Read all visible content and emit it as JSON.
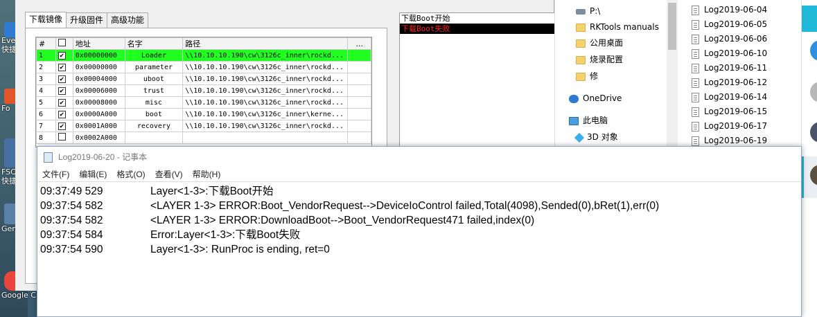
{
  "desktop": {
    "icons": [
      {
        "label": "Every\n快捷",
        "color": "#2f7bd4"
      },
      {
        "label": "Fo",
        "color": "#e2572a"
      },
      {
        "label": "FSCa\n快捷",
        "color": "#4a6fa5"
      },
      {
        "label": "Ger",
        "color": "#5a7fa8"
      },
      {
        "label": "Google Ch",
        "color": "#e8453c"
      }
    ]
  },
  "rk": {
    "tabs": [
      "下载镜像",
      "升级固件",
      "高级功能"
    ],
    "columns": [
      "#",
      "",
      "地址",
      "名字",
      "路径",
      "..."
    ],
    "rows": [
      {
        "num": "1",
        "addr": "0x00000000",
        "name": "Loader",
        "path": "\\\\10.10.10.190\\cw\\3126c_inner\\rockd..."
      },
      {
        "num": "2",
        "addr": "0x00000000",
        "name": "parameter",
        "path": "\\\\10.10.10.190\\cw\\3126c_inner\\rockd..."
      },
      {
        "num": "3",
        "addr": "0x00004000",
        "name": "uboot",
        "path": "\\\\10.10.10.190\\cw\\3126c_inner\\rockd..."
      },
      {
        "num": "4",
        "addr": "0x00006000",
        "name": "trust",
        "path": "\\\\10.10.10.190\\cw\\3126c_inner\\rockd..."
      },
      {
        "num": "5",
        "addr": "0x00008000",
        "name": "misc",
        "path": "\\\\10.10.10.190\\cw\\3126c_inner\\rockd..."
      },
      {
        "num": "6",
        "addr": "0x0000A000",
        "name": "boot",
        "path": "\\\\10.10.10.190\\cw\\3126c_inner\\kerne..."
      },
      {
        "num": "7",
        "addr": "0x0001A000",
        "name": "recovery",
        "path": "\\\\10.10.10.190\\cw\\3126c_inner\\rockd..."
      },
      {
        "num": "8",
        "addr": "0x0002A000",
        "name": "",
        "path": ""
      }
    ],
    "log": [
      {
        "text": "下载Boot开始",
        "error": false
      },
      {
        "text": "下载Boot失败",
        "error": true
      }
    ]
  },
  "explorer": {
    "nav": [
      {
        "label": "P:\\",
        "type": "drive",
        "pinned": true
      },
      {
        "label": "RKTools manuals",
        "type": "folder"
      },
      {
        "label": "公用桌面",
        "type": "folder"
      },
      {
        "label": "烧录配置",
        "type": "folder"
      },
      {
        "label": "修",
        "type": "folder"
      },
      {
        "label": "OneDrive",
        "type": "cloud"
      },
      {
        "label": "此电脑",
        "type": "pc"
      },
      {
        "label": "3D 对象",
        "type": "obj3d"
      }
    ],
    "files": [
      "Log2019-06-04",
      "Log2019-06-05",
      "Log2019-06-06",
      "Log2019-06-10",
      "Log2019-06-11",
      "Log2019-06-12",
      "Log2019-06-14",
      "Log2019-06-15",
      "Log2019-06-17",
      "Log2019-06-19"
    ]
  },
  "notepad": {
    "title": "Log2019-06-20 - 记事本",
    "menu": [
      "文件(F)",
      "编辑(E)",
      "格式(O)",
      "查看(V)",
      "帮助(H)"
    ],
    "lines": [
      {
        "time": "09:37:49 529",
        "msg": "Layer<1-3>:下载Boot开始"
      },
      {
        "time": "09:37:54 582",
        "msg": "<LAYER 1-3> ERROR:Boot_VendorRequest-->DeviceIoControl failed,Total(4098),Sended(0),bRet(1),err(0)"
      },
      {
        "time": "09:37:54 582",
        "msg": "<LAYER 1-3> ERROR:DownloadBoot-->Boot_VendorRequest471 failed,index(0)"
      },
      {
        "time": "09:37:54 584",
        "msg": "Error:Layer<1-3>:下载Boot失败"
      },
      {
        "time": "09:37:54 590",
        "msg": "Layer<1-3>: RunProc is ending, ret=0"
      }
    ]
  },
  "colors": {
    "selected_row": "#20ff20",
    "error_bg": "#000000",
    "error_text": "#ff2020",
    "accent": "#1fb8d6"
  }
}
